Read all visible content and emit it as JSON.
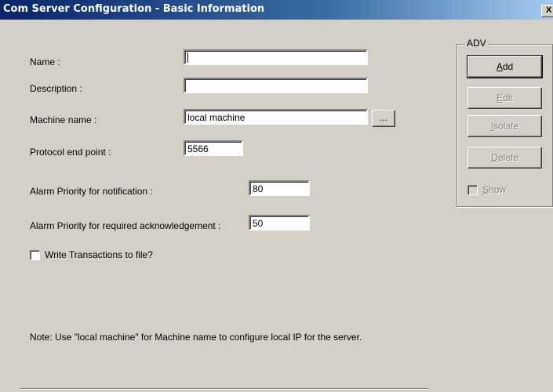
{
  "window": {
    "title": "Com Server Configuration - Basic Information",
    "close_label": "X"
  },
  "form": {
    "name_label": "Name :",
    "name_value": "",
    "description_label": "Description :",
    "description_value": "",
    "machine_label": "Machine name :",
    "machine_value": "local machine",
    "browse_label": "...",
    "protocol_label": "Protocol end point :",
    "protocol_value": "5566",
    "alarm_notify_label": "Alarm Priority for notification :",
    "alarm_notify_value": "80",
    "alarm_ack_label": "Alarm Priority for required acknowledgement :",
    "alarm_ack_value": "50",
    "write_tx_label": "Write Transactions to file?",
    "write_tx_checked": false,
    "note": "Note: Use \"local machine\" for Machine name to configure local IP for the server."
  },
  "adv": {
    "legend": "ADV",
    "buttons": [
      {
        "label": "Add",
        "mnemonic": "A",
        "rest": "dd",
        "enabled": true
      },
      {
        "label": "Edit",
        "mnemonic": "E",
        "rest": "dit",
        "enabled": false
      },
      {
        "label": "Isolate",
        "mnemonic": "I",
        "rest": "solate",
        "enabled": false
      },
      {
        "label": "Delete",
        "mnemonic": "D",
        "rest": "elete",
        "enabled": false
      }
    ],
    "show_label": "Show",
    "show_mnemonic": "S",
    "show_rest": "how",
    "show_checked": false
  }
}
